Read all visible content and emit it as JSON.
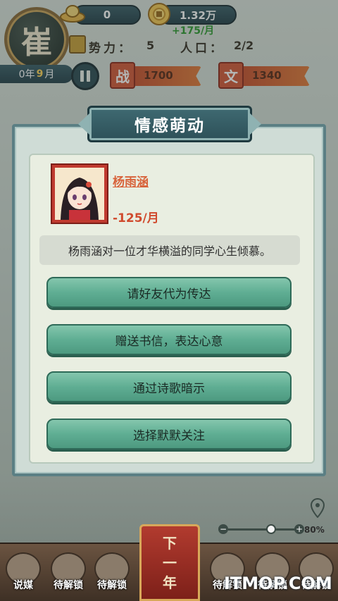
{
  "hud": {
    "emblem_char": "崔",
    "silver": "0",
    "gold": "1.32万",
    "gold_income": "+175/月",
    "power_label": "势力：",
    "power_value": "5",
    "population_label": "人口：",
    "population_value": "2/2",
    "year_prefix": "0年",
    "month": "9",
    "month_suffix": "月",
    "war_label": "战",
    "war_value": "1700",
    "culture_label": "文",
    "culture_value": "1340"
  },
  "dialog": {
    "title": "情感萌动",
    "character_name": "杨雨涵",
    "character_cost": "-125/月",
    "description": "杨雨涵对一位才华横溢的同学心生倾慕。",
    "choices": [
      "请好友代为传达",
      "赠送书信，表达心意",
      "通过诗歌暗示",
      "选择默默关注"
    ]
  },
  "map": {
    "zoom_label": "80%",
    "zoom_level": 0.8
  },
  "bottom": {
    "slots": [
      "说媒",
      "待解锁",
      "待解锁",
      "待解锁",
      "待解锁",
      "待解锁"
    ],
    "next_chars": [
      "下",
      "一",
      "年"
    ]
  },
  "watermark": "ITMOP.COM",
  "colors": {
    "accent_green": "#5fae93",
    "title_teal": "#2d5058",
    "name_orange": "#d8633b",
    "cost_red": "#d04a2d",
    "income_green": "#2f9a30"
  }
}
